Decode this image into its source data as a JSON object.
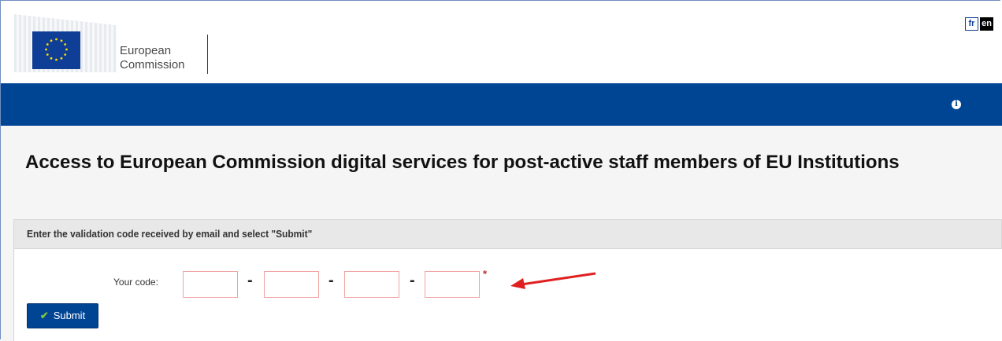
{
  "header": {
    "logo_line1": "European",
    "logo_line2": "Commission",
    "languages": [
      {
        "code": "fr",
        "active": false
      },
      {
        "code": "en",
        "active": true
      }
    ]
  },
  "toolbar": {
    "info_icon": "info-icon",
    "info_glyph": "i"
  },
  "page": {
    "title": "Access to European Commission digital services for post-active staff members of EU Institutions"
  },
  "form": {
    "instruction": "Enter the validation code received by email and select \"Submit\"",
    "code_label": "Your code:",
    "code_values": [
      "",
      "",
      "",
      ""
    ],
    "separator": "-",
    "required_mark": "*",
    "submit_label": "Submit",
    "submit_icon": "check-icon"
  },
  "colors": {
    "brand_blue": "#004494",
    "required_red": "#c62828",
    "check_green": "#7cc243",
    "arrow_red": "#e02020"
  }
}
